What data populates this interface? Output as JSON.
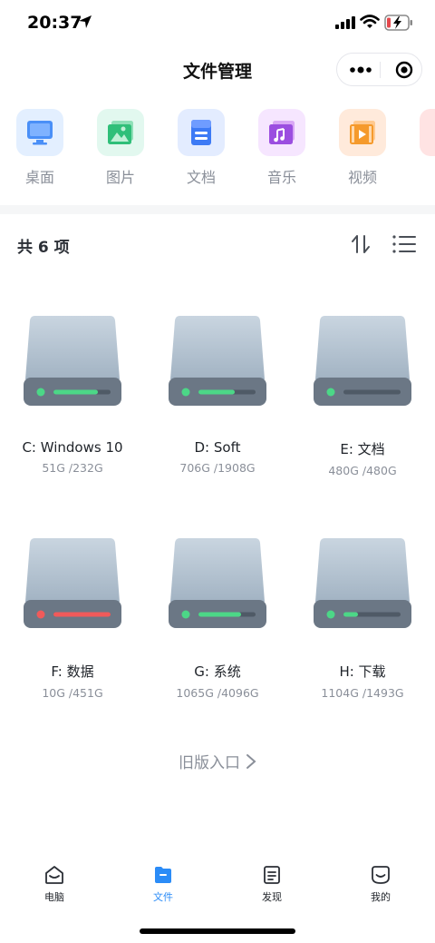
{
  "status": {
    "time": "20:37"
  },
  "nav": {
    "title": "文件管理"
  },
  "categories": [
    {
      "label": "桌面",
      "icon": "monitor-icon",
      "bg": "#e3efff"
    },
    {
      "label": "图片",
      "icon": "image-icon",
      "bg": "#e2f8ef"
    },
    {
      "label": "文档",
      "icon": "document-icon",
      "bg": "#e3ecff"
    },
    {
      "label": "音乐",
      "icon": "music-icon",
      "bg": "#f6e6ff"
    },
    {
      "label": "视频",
      "icon": "video-icon",
      "bg": "#ffeadb"
    }
  ],
  "list": {
    "count_label": "共 6 项"
  },
  "drives": [
    {
      "name": "C: Windows 10",
      "size": "51G /232G",
      "used_fraction": 0.78,
      "status_color": "#4cd787"
    },
    {
      "name": "D: Soft",
      "size": "706G /1908G",
      "used_fraction": 0.63,
      "status_color": "#4cd787"
    },
    {
      "name": "E: 文档",
      "size": "480G /480G",
      "used_fraction": 0.0,
      "status_color": "#4cd787"
    },
    {
      "name": "F: 数据",
      "size": "10G /451G",
      "used_fraction": 1.0,
      "status_color": "#f05a5a"
    },
    {
      "name": "G: 系统",
      "size": "1065G /4096G",
      "used_fraction": 0.74,
      "status_color": "#4cd787"
    },
    {
      "name": "H: 下载",
      "size": "1104G /1493G",
      "used_fraction": 0.26,
      "status_color": "#4cd787"
    }
  ],
  "old_entry": {
    "label": "旧版入口"
  },
  "tabs": [
    {
      "label": "电脑",
      "icon": "computer-icon",
      "active": false
    },
    {
      "label": "文件",
      "icon": "folder-icon",
      "active": true
    },
    {
      "label": "发现",
      "icon": "discover-icon",
      "active": false
    },
    {
      "label": "我的",
      "icon": "profile-icon",
      "active": false
    }
  ],
  "colors": {
    "accent": "#2b8cf7",
    "drive_body": "#b8c6d4",
    "drive_base": "#6b7785"
  }
}
